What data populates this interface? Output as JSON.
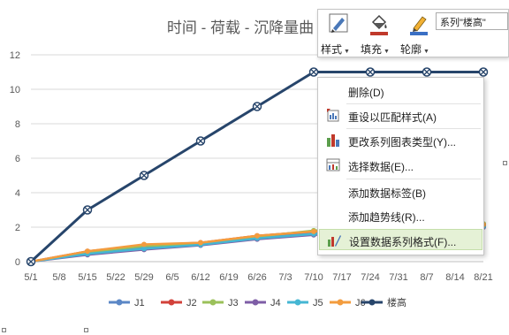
{
  "chart": {
    "title": "时间 - 荷载 - 沉降量曲",
    "colors": {
      "J1": "#5b87c6",
      "J2": "#d2413a",
      "J3": "#9bc15a",
      "J4": "#7e5da6",
      "J5": "#45b6d3",
      "J6": "#f39c3e",
      "楼高": "#27456b"
    }
  },
  "chart_data": {
    "type": "line",
    "x": [
      "5/1",
      "5/8",
      "5/15",
      "5/22",
      "5/29",
      "6/5",
      "6/12",
      "6/19",
      "6/26",
      "7/3",
      "7/10",
      "7/17",
      "7/24",
      "7/31",
      "8/7",
      "8/14",
      "8/21"
    ],
    "ylim": [
      0,
      12
    ],
    "yticks": [
      0,
      2,
      4,
      6,
      8,
      10,
      12
    ],
    "series": [
      {
        "name": "J1",
        "points": [
          [
            "5/1",
            0
          ],
          [
            "5/15",
            0.5
          ],
          [
            "5/29",
            0.8
          ],
          [
            "6/12",
            1.0
          ],
          [
            "6/26",
            1.4
          ],
          [
            "7/10",
            1.7
          ],
          [
            "7/24",
            1.9
          ],
          [
            "8/7",
            2.0
          ],
          [
            "8/21",
            2.1
          ]
        ]
      },
      {
        "name": "J2",
        "points": [
          [
            "5/1",
            0
          ],
          [
            "5/15",
            0.6
          ],
          [
            "5/29",
            0.95
          ],
          [
            "6/12",
            1.1
          ],
          [
            "6/26",
            1.5
          ],
          [
            "7/10",
            1.75
          ],
          [
            "7/24",
            1.95
          ],
          [
            "8/7",
            2.05
          ],
          [
            "8/21",
            2.15
          ]
        ]
      },
      {
        "name": "J3",
        "points": [
          [
            "5/1",
            0
          ],
          [
            "5/15",
            0.55
          ],
          [
            "5/29",
            0.9
          ],
          [
            "6/12",
            1.05
          ],
          [
            "6/26",
            1.45
          ],
          [
            "7/10",
            1.8
          ],
          [
            "7/24",
            2.0
          ],
          [
            "8/7",
            2.1
          ],
          [
            "8/21",
            2.2
          ]
        ]
      },
      {
        "name": "J4",
        "points": [
          [
            "5/1",
            0
          ],
          [
            "5/15",
            0.4
          ],
          [
            "5/29",
            0.7
          ],
          [
            "6/12",
            0.95
          ],
          [
            "6/26",
            1.3
          ],
          [
            "7/10",
            1.55
          ],
          [
            "7/24",
            1.75
          ],
          [
            "8/7",
            1.9
          ],
          [
            "8/21",
            2.0
          ]
        ]
      },
      {
        "name": "J5",
        "points": [
          [
            "5/1",
            0
          ],
          [
            "5/15",
            0.45
          ],
          [
            "5/29",
            0.75
          ],
          [
            "6/12",
            0.98
          ],
          [
            "6/26",
            1.35
          ],
          [
            "7/10",
            1.6
          ],
          [
            "7/24",
            1.8
          ],
          [
            "8/7",
            1.95
          ],
          [
            "8/21",
            2.05
          ]
        ]
      },
      {
        "name": "J6",
        "points": [
          [
            "5/1",
            0
          ],
          [
            "5/15",
            0.6
          ],
          [
            "5/29",
            1.0
          ],
          [
            "6/12",
            1.1
          ],
          [
            "6/26",
            1.5
          ],
          [
            "7/10",
            1.75
          ],
          [
            "7/24",
            1.95
          ],
          [
            "8/7",
            2.05
          ],
          [
            "8/21",
            2.15
          ]
        ]
      },
      {
        "name": "楼高",
        "selected": true,
        "points": [
          [
            "5/1",
            0
          ],
          [
            "5/15",
            3
          ],
          [
            "5/29",
            5
          ],
          [
            "6/12",
            7
          ],
          [
            "6/26",
            9
          ],
          [
            "7/10",
            11
          ],
          [
            "7/24",
            11
          ],
          [
            "8/7",
            11
          ],
          [
            "8/21",
            11
          ]
        ]
      }
    ]
  },
  "toolbar": {
    "style_label": "样式",
    "fill_label": "填充",
    "outline_label": "轮廓",
    "series_selected": "系列\"楼高\"",
    "fill_color": "#c0392b",
    "outline_color": "#3a6fc4"
  },
  "context_menu": {
    "items": [
      {
        "label": "删除(D)",
        "icon": "none"
      },
      {
        "label": "重设以匹配样式(A)",
        "icon": "reset-style-icon"
      },
      {
        "label": "更改系列图表类型(Y)...",
        "icon": "change-chart-type-icon"
      },
      {
        "label": "选择数据(E)...",
        "icon": "select-data-icon"
      },
      {
        "label": "添加数据标签(B)",
        "icon": "none"
      },
      {
        "label": "添加趋势线(R)...",
        "icon": "none"
      },
      {
        "label": "设置数据系列格式(F)...",
        "icon": "format-series-icon",
        "highlighted": true
      }
    ]
  }
}
